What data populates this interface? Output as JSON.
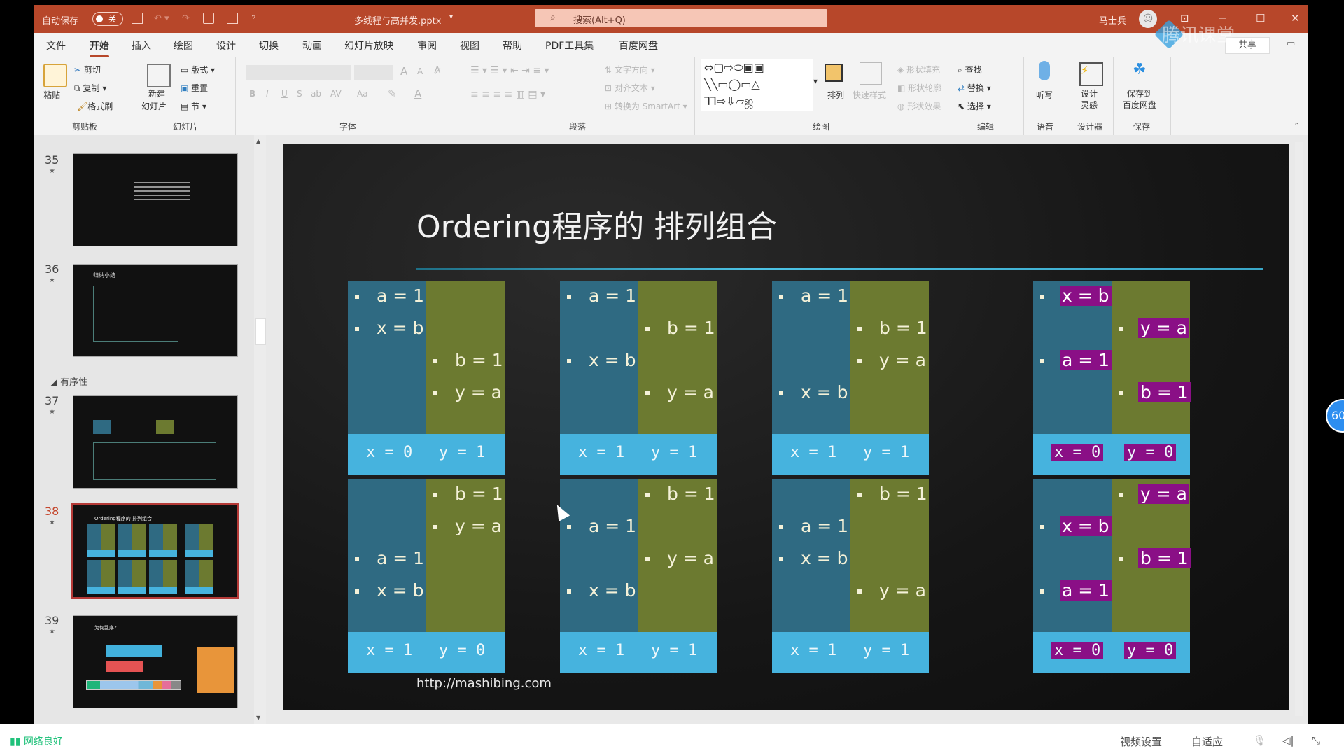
{
  "titlebar": {
    "autosave_label": "自动保存",
    "autosave_state": "关",
    "filename": "多线程与高并发.pptx",
    "filename_caret": "▾",
    "search_placeholder": "搜索(Alt+Q)",
    "user_name": "马士兵",
    "controls": {
      "ribbon_display": "⊡",
      "minimize": "─",
      "maximize": "☐",
      "close": "✕"
    }
  },
  "tabs": [
    "文件",
    "开始",
    "插入",
    "绘图",
    "设计",
    "切换",
    "动画",
    "幻灯片放映",
    "审阅",
    "视图",
    "帮助",
    "PDF工具集",
    "百度网盘"
  ],
  "active_tab": "开始",
  "share_label": "共享",
  "ribbon": {
    "clipboard": {
      "paste": "粘贴",
      "cut": "剪切",
      "copy": "复制",
      "format_painter": "格式刷",
      "label": "剪贴板"
    },
    "slides": {
      "new_slide_1": "新建",
      "new_slide_2": "幻灯片",
      "layout": "版式",
      "reset": "重置",
      "section": "节",
      "label": "幻灯片"
    },
    "font": {
      "bold": "B",
      "italic": "I",
      "underline": "U",
      "strike": "S",
      "spacing": "AV",
      "case": "Aa",
      "grow": "A",
      "shrink": "A",
      "label": "字体"
    },
    "paragraph": {
      "text_direction": "文字方向",
      "align_text": "对齐文本",
      "smartart": "转换为 SmartArt",
      "label": "段落"
    },
    "drawing": {
      "arrange": "排列",
      "quick_styles": "快速样式",
      "fill": "形状填充",
      "outline": "形状轮廓",
      "effects": "形状效果",
      "label": "绘图"
    },
    "editing": {
      "find": "查找",
      "replace": "替换",
      "select": "选择",
      "label": "编辑"
    },
    "voice": {
      "dictate": "听写",
      "label": "语音"
    },
    "designer": {
      "ideas_1": "设计",
      "ideas_2": "灵感",
      "label": "设计器"
    },
    "save": {
      "baidu_1": "保存到",
      "baidu_2": "百度网盘",
      "label": "保存"
    }
  },
  "thumbnails": [
    {
      "number": "35",
      "selected": false
    },
    {
      "number": "36",
      "selected": false,
      "title": "归纳小结"
    },
    {
      "number": "37",
      "selected": false,
      "section": "有序性"
    },
    {
      "number": "38",
      "selected": true,
      "title": "Ordering程序的 排列组合"
    },
    {
      "number": "39",
      "selected": false,
      "title": "为何乱序?"
    }
  ],
  "slide": {
    "title": "Ordering程序的 排列组合",
    "url": "http://mashibing.com",
    "colors": {
      "left": "#2f6a82",
      "right": "#6c7a30",
      "result": "#46b3de",
      "highlight": "#8a0f86"
    },
    "cards": [
      {
        "left": [
          {
            "text": "a = 1",
            "slot": 0
          },
          {
            "text": "x = b",
            "slot": 1
          }
        ],
        "right": [
          {
            "text": "b = 1",
            "slot": 2
          },
          {
            "text": "y = a",
            "slot": 3
          }
        ],
        "x": "x = 0",
        "y": "y = 1",
        "highlight": false
      },
      {
        "left": [
          {
            "text": "a = 1",
            "slot": 0
          },
          {
            "text": "x = b",
            "slot": 2
          }
        ],
        "right": [
          {
            "text": "b = 1",
            "slot": 1
          },
          {
            "text": "y = a",
            "slot": 3
          }
        ],
        "x": "x = 1",
        "y": "y = 1",
        "highlight": false
      },
      {
        "left": [
          {
            "text": "a = 1",
            "slot": 0
          },
          {
            "text": "x = b",
            "slot": 3
          }
        ],
        "right": [
          {
            "text": "b = 1",
            "slot": 1
          },
          {
            "text": "y = a",
            "slot": 2
          }
        ],
        "x": "x = 1",
        "y": "y = 1",
        "highlight": false
      },
      {
        "left": [
          {
            "text": "x = b",
            "slot": 0
          },
          {
            "text": "a = 1",
            "slot": 2
          }
        ],
        "right": [
          {
            "text": "y = a",
            "slot": 1
          },
          {
            "text": "b = 1",
            "slot": 3
          }
        ],
        "x": "x = 0",
        "y": "y = 0",
        "highlight": true
      },
      {
        "left": [
          {
            "text": "a = 1",
            "slot": 2
          },
          {
            "text": "x = b",
            "slot": 3
          }
        ],
        "right": [
          {
            "text": "b = 1",
            "slot": 0
          },
          {
            "text": "y = a",
            "slot": 1
          }
        ],
        "x": "x = 1",
        "y": "y = 0",
        "highlight": false
      },
      {
        "left": [
          {
            "text": "a = 1",
            "slot": 1
          },
          {
            "text": "x = b",
            "slot": 3
          }
        ],
        "right": [
          {
            "text": "b = 1",
            "slot": 0
          },
          {
            "text": "y = a",
            "slot": 2
          }
        ],
        "x": "x = 1",
        "y": "y = 1",
        "highlight": false
      },
      {
        "left": [
          {
            "text": "a = 1",
            "slot": 1
          },
          {
            "text": "x = b",
            "slot": 2
          }
        ],
        "right": [
          {
            "text": "b = 1",
            "slot": 0
          },
          {
            "text": "y = a",
            "slot": 3
          }
        ],
        "x": "x = 1",
        "y": "y = 1",
        "highlight": false
      },
      {
        "left": [
          {
            "text": "x = b",
            "slot": 1
          },
          {
            "text": "a = 1",
            "slot": 3
          }
        ],
        "right": [
          {
            "text": "y = a",
            "slot": 0
          },
          {
            "text": "b = 1",
            "slot": 2
          }
        ],
        "x": "x = 0",
        "y": "y = 0",
        "highlight": true
      }
    ]
  },
  "statusbar": {
    "network": "网络良好",
    "video_settings": "视频设置",
    "adaptive": "自适应"
  },
  "overlay": {
    "watermark": "腾讯课堂",
    "badge": "60"
  }
}
